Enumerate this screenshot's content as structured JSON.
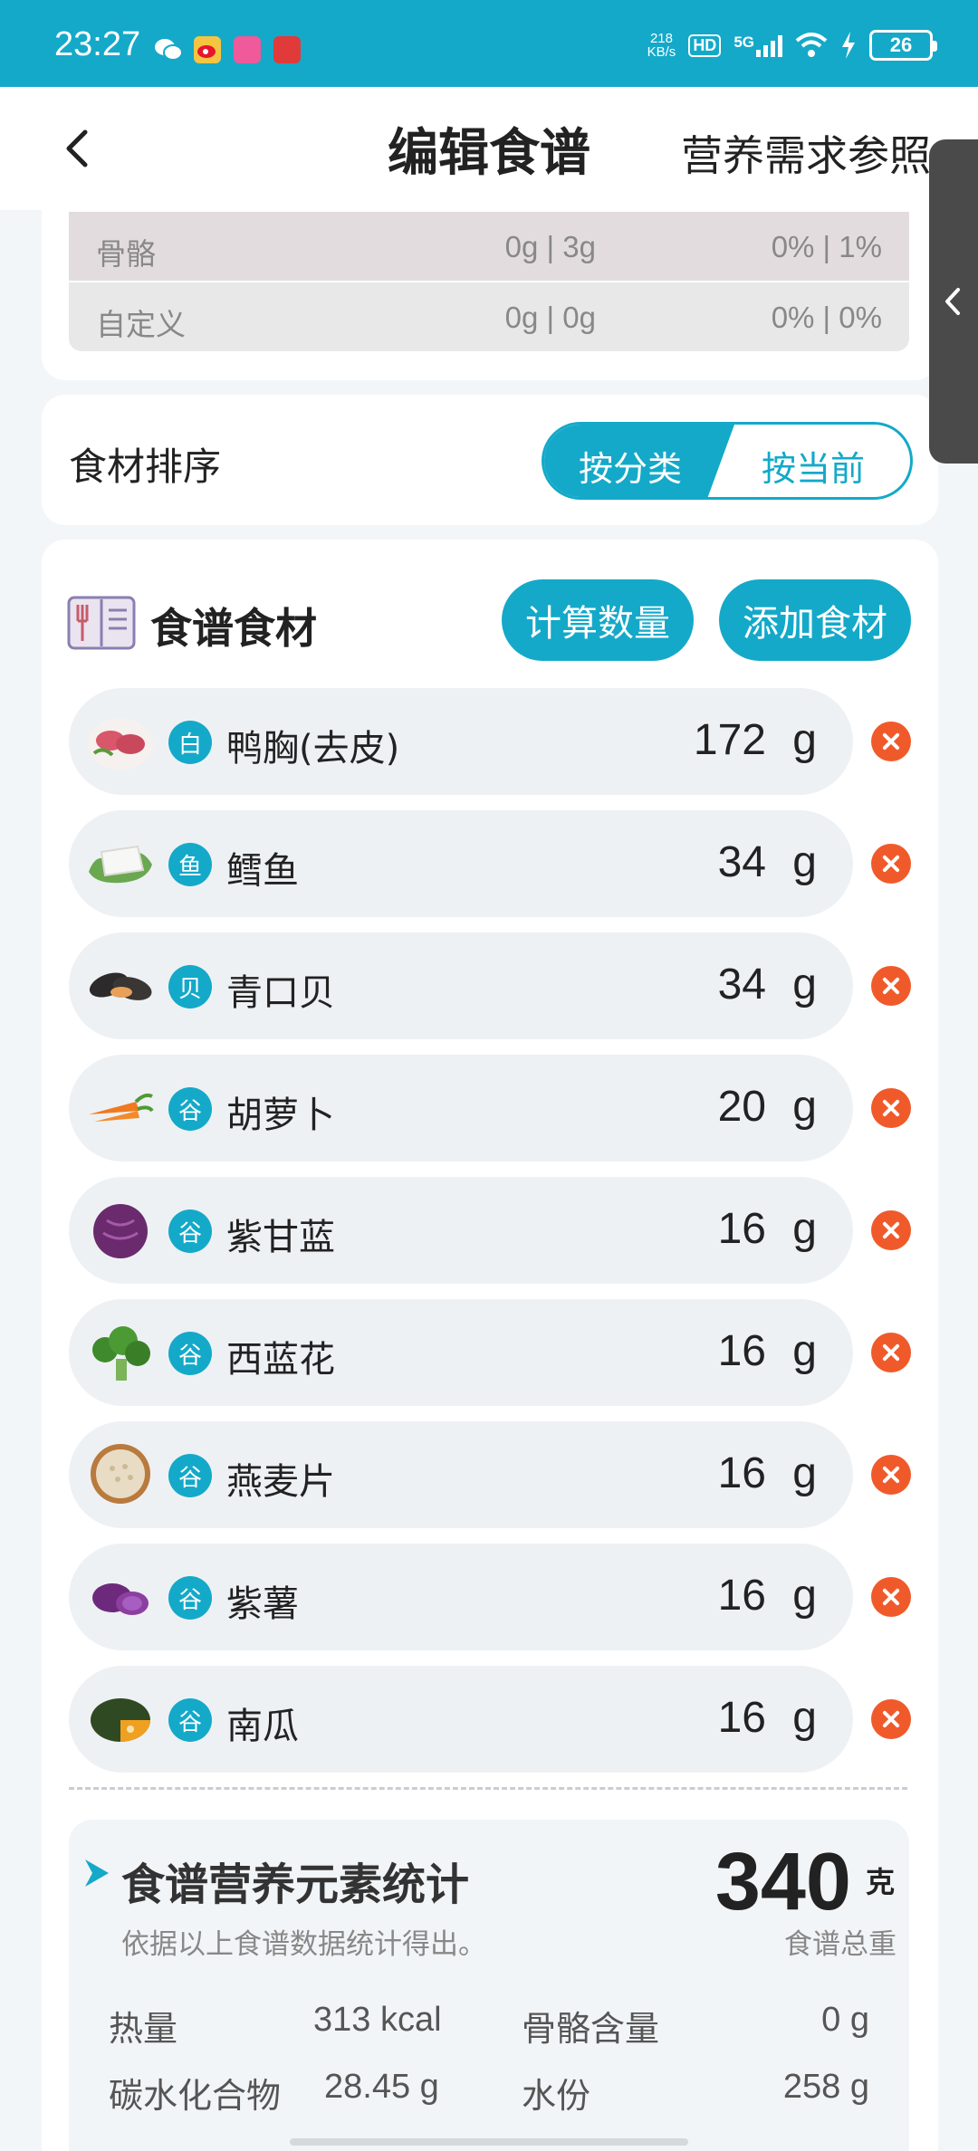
{
  "status_bar": {
    "time": "23:27",
    "net_speed_value": "218",
    "net_speed_unit": "KB/s",
    "hd": "HD",
    "network": "5G",
    "battery": "26"
  },
  "header": {
    "title": "编辑食谱",
    "reference_link": "营养需求参照"
  },
  "nutrient_rows": [
    {
      "name": "骨骼",
      "amount": "0g | 3g",
      "percent": "0% | 1%"
    },
    {
      "name": "自定义",
      "amount": "0g | 0g",
      "percent": "0% | 0%"
    }
  ],
  "sort": {
    "label": "食材排序",
    "option_category": "按分类",
    "option_current": "按当前",
    "selected": "按分类"
  },
  "ingredients_section": {
    "title": "食谱食材",
    "calc_button": "计算数量",
    "add_button": "添加食材"
  },
  "ingredients": [
    {
      "category": "白",
      "name": "鸭胸(去皮)",
      "qty": "172",
      "unit": "g",
      "image": "duck-breast"
    },
    {
      "category": "鱼",
      "name": "鳕鱼",
      "qty": "34",
      "unit": "g",
      "image": "cod"
    },
    {
      "category": "贝",
      "name": "青口贝",
      "qty": "34",
      "unit": "g",
      "image": "mussel"
    },
    {
      "category": "谷",
      "name": "胡萝卜",
      "qty": "20",
      "unit": "g",
      "image": "carrot"
    },
    {
      "category": "谷",
      "name": "紫甘蓝",
      "qty": "16",
      "unit": "g",
      "image": "red-cabbage"
    },
    {
      "category": "谷",
      "name": "西蓝花",
      "qty": "16",
      "unit": "g",
      "image": "broccoli"
    },
    {
      "category": "谷",
      "name": "燕麦片",
      "qty": "16",
      "unit": "g",
      "image": "oats"
    },
    {
      "category": "谷",
      "name": "紫薯",
      "qty": "16",
      "unit": "g",
      "image": "purple-potato"
    },
    {
      "category": "谷",
      "name": "南瓜",
      "qty": "16",
      "unit": "g",
      "image": "pumpkin"
    }
  ],
  "stats": {
    "title": "食谱营养元素统计",
    "subtitle": "依据以上食谱数据统计得出。",
    "total_weight": "340",
    "total_unit": "克",
    "total_label": "食谱总重",
    "items": [
      {
        "label": "热量",
        "value": "313 kcal"
      },
      {
        "label": "骨骼含量",
        "value": "0 g"
      },
      {
        "label": "碳水化合物",
        "value": "28.45 g"
      },
      {
        "label": "水份",
        "value": "258 g"
      }
    ]
  },
  "colors": {
    "accent": "#14a9c9",
    "delete": "#f05a2a",
    "row_bg": "#eef1f4"
  }
}
